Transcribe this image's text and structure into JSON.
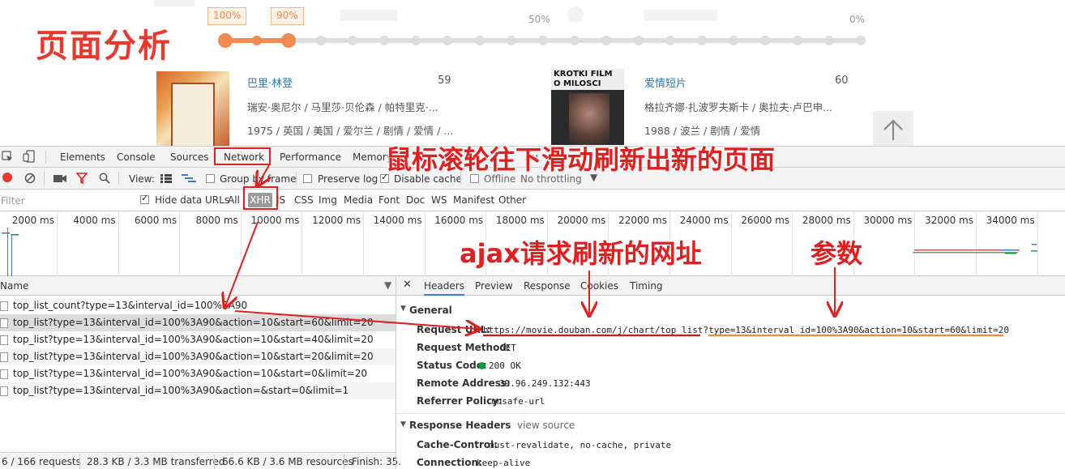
{
  "page": {
    "title_overlay": "页面分析",
    "slider": {
      "left_label": "100%",
      "selected_label": "90%",
      "mid_label": "50%",
      "right_label": "0%",
      "value_percent": 90
    },
    "movies": [
      {
        "title": "巴里·林登",
        "score": "59",
        "cast": "瑞安·奥尼尔 / 马里莎·贝伦森 / 帕特里克·...",
        "info": "1975 / 英国 / 美国 / 爱尔兰 / 剧情 / 爱情 / ..."
      },
      {
        "title": "爱情短片",
        "score": "60",
        "cast": "格拉齐娜·扎波罗夫斯卡 / 奥拉夫·卢巴申...",
        "info": "1988 / 波兰 / 剧情 / 爱情",
        "poster_text": "KROTKI FILM O MILOSCI"
      }
    ]
  },
  "devtools": {
    "main_tabs": [
      "Elements",
      "Console",
      "Sources",
      "Network",
      "Performance",
      "Memory",
      "Au"
    ],
    "active_tab": "Network",
    "toolbar": {
      "view_label": "View:",
      "group_by_frame": "Group by frame",
      "preserve_log": "Preserve log",
      "disable_cache": "Disable cache",
      "offline": "Offline",
      "throttling": "No throttling"
    },
    "filter": {
      "placeholder": "Filter",
      "hide_data_urls": "Hide data URLs",
      "types": [
        "All",
        "XHR",
        "JS",
        "CSS",
        "Img",
        "Media",
        "Font",
        "Doc",
        "WS",
        "Manifest",
        "Other"
      ],
      "active_type": "XHR"
    },
    "timeline_ticks": [
      "2000 ms",
      "4000 ms",
      "6000 ms",
      "8000 ms",
      "10000 ms",
      "12000 ms",
      "14000 ms",
      "16000 ms",
      "18000 ms",
      "20000 ms",
      "22000 ms",
      "24000 ms",
      "26000 ms",
      "28000 ms",
      "30000 ms",
      "32000 ms",
      "34000 ms",
      "3"
    ],
    "name_header": "Name",
    "requests": [
      "top_list_count?type=13&interval_id=100%3A90",
      "top_list?type=13&interval_id=100%3A90&action=10&start=60&limit=20",
      "top_list?type=13&interval_id=100%3A90&action=10&start=40&limit=20",
      "top_list?type=13&interval_id=100%3A90&action=10&start=20&limit=20",
      "top_list?type=13&interval_id=100%3A90&action=10&start=0&limit=20",
      "top_list?type=13&interval_id=100%3A90&action=&start=0&limit=1"
    ],
    "selected_request_index": 1,
    "status_bar": {
      "requests": "6 / 166 requests",
      "transferred": "28.3 KB / 3.3 MB transferred",
      "resources": "66.6 KB / 3.6 MB resources",
      "finish": "Finish: 35."
    },
    "detail_tabs": [
      "Headers",
      "Preview",
      "Response",
      "Cookies",
      "Timing"
    ],
    "active_detail_tab": "Headers",
    "general": {
      "title": "General",
      "request_url_key": "Request URL:",
      "request_url_base": "https://movie.douban.com/j/chart/top_list",
      "request_url_query": "?type=13&interval_id=100%3A90&action=10&start=60&limit=20",
      "method_key": "Request Method:",
      "method": "GET",
      "status_key": "Status Code:",
      "status": "200 OK",
      "remote_key": "Remote Address:",
      "remote": "39.96.249.132:443",
      "referrer_key": "Referrer Policy:",
      "referrer": "unsafe-url"
    },
    "response_headers": {
      "title": "Response Headers",
      "view_source": "view source",
      "cache_key": "Cache-Control:",
      "cache": "must-revalidate, no-cache, private",
      "conn_key": "Connection:",
      "conn": "keep-alive"
    }
  },
  "annotations": {
    "scroll_note": "鼠标滚轮往下滑动刷新出新的页面",
    "ajax_note": "ajax请求刷新的网址",
    "params_note": "参数",
    "color": "#e02020"
  }
}
